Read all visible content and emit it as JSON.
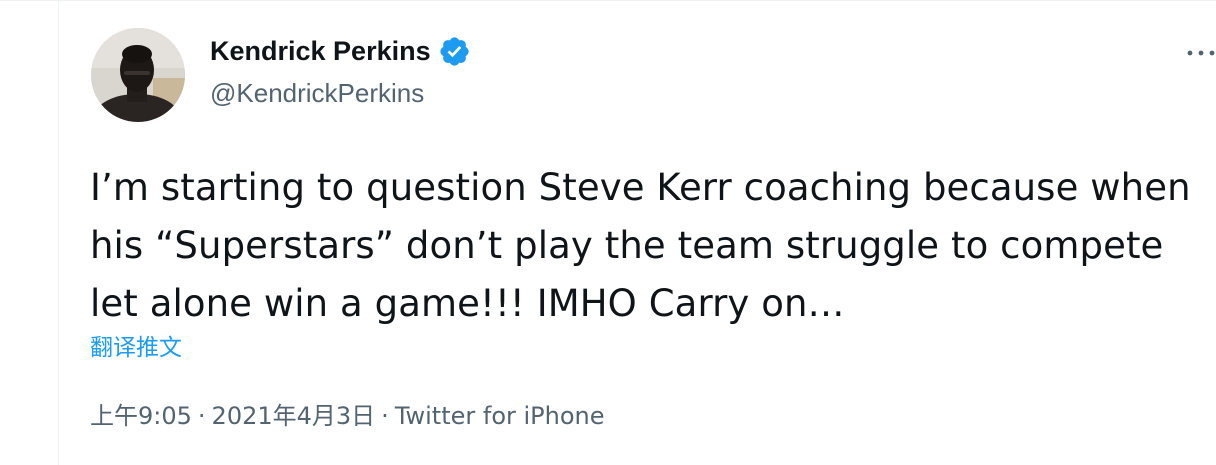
{
  "author": {
    "name": "Kendrick Perkins",
    "handle": "@KendrickPerkins",
    "verified": true
  },
  "tweet": {
    "text": "I’m starting to question Steve Kerr coaching because when his “Superstars” don’t play the team struggle to compete let alone win a game!!! IMHO Carry on…",
    "translate_label": "翻译推文",
    "time": "上午9:05",
    "date": "2021年4月3日",
    "separator": "·",
    "source": "Twitter for iPhone"
  },
  "icons": {
    "verified": "verified-badge-icon",
    "more": "more-options-icon"
  },
  "colors": {
    "accent": "#1d9bf0",
    "text": "#0f1419",
    "secondary": "#536471"
  }
}
